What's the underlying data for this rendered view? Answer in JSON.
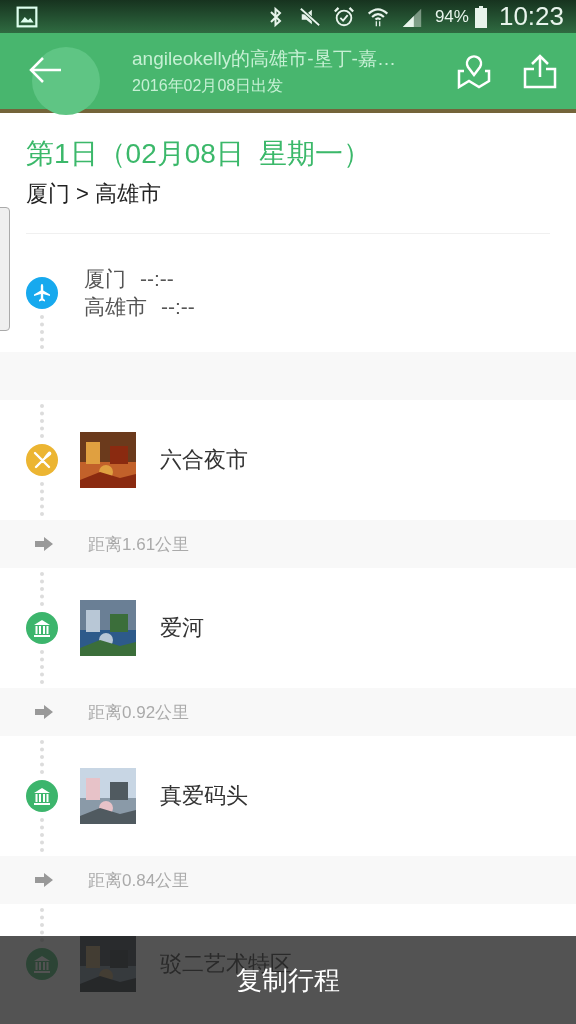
{
  "status_bar": {
    "battery": "94%",
    "time": "10:23"
  },
  "toolbar": {
    "title": "angileokelly的高雄市-垦丁-嘉…",
    "subtitle": "2016年02月08日出发"
  },
  "day": {
    "heading": "第1日（02月08日  星期一）",
    "route": "厦门 > 高雄市"
  },
  "flight": {
    "stops": [
      {
        "city": "厦门",
        "time": "--:--"
      },
      {
        "city": "高雄市",
        "time": "--:--"
      }
    ]
  },
  "stops": [
    {
      "kind": "food",
      "name": "六合夜市",
      "distance": "距离1.61公里"
    },
    {
      "kind": "sight",
      "name": "爱河",
      "distance": "距离0.92公里"
    },
    {
      "kind": "sight",
      "name": "真爱码头",
      "distance": "距离0.84公里"
    },
    {
      "kind": "sight",
      "name": "驳二艺术特区"
    }
  ],
  "toast": "复制行程"
}
